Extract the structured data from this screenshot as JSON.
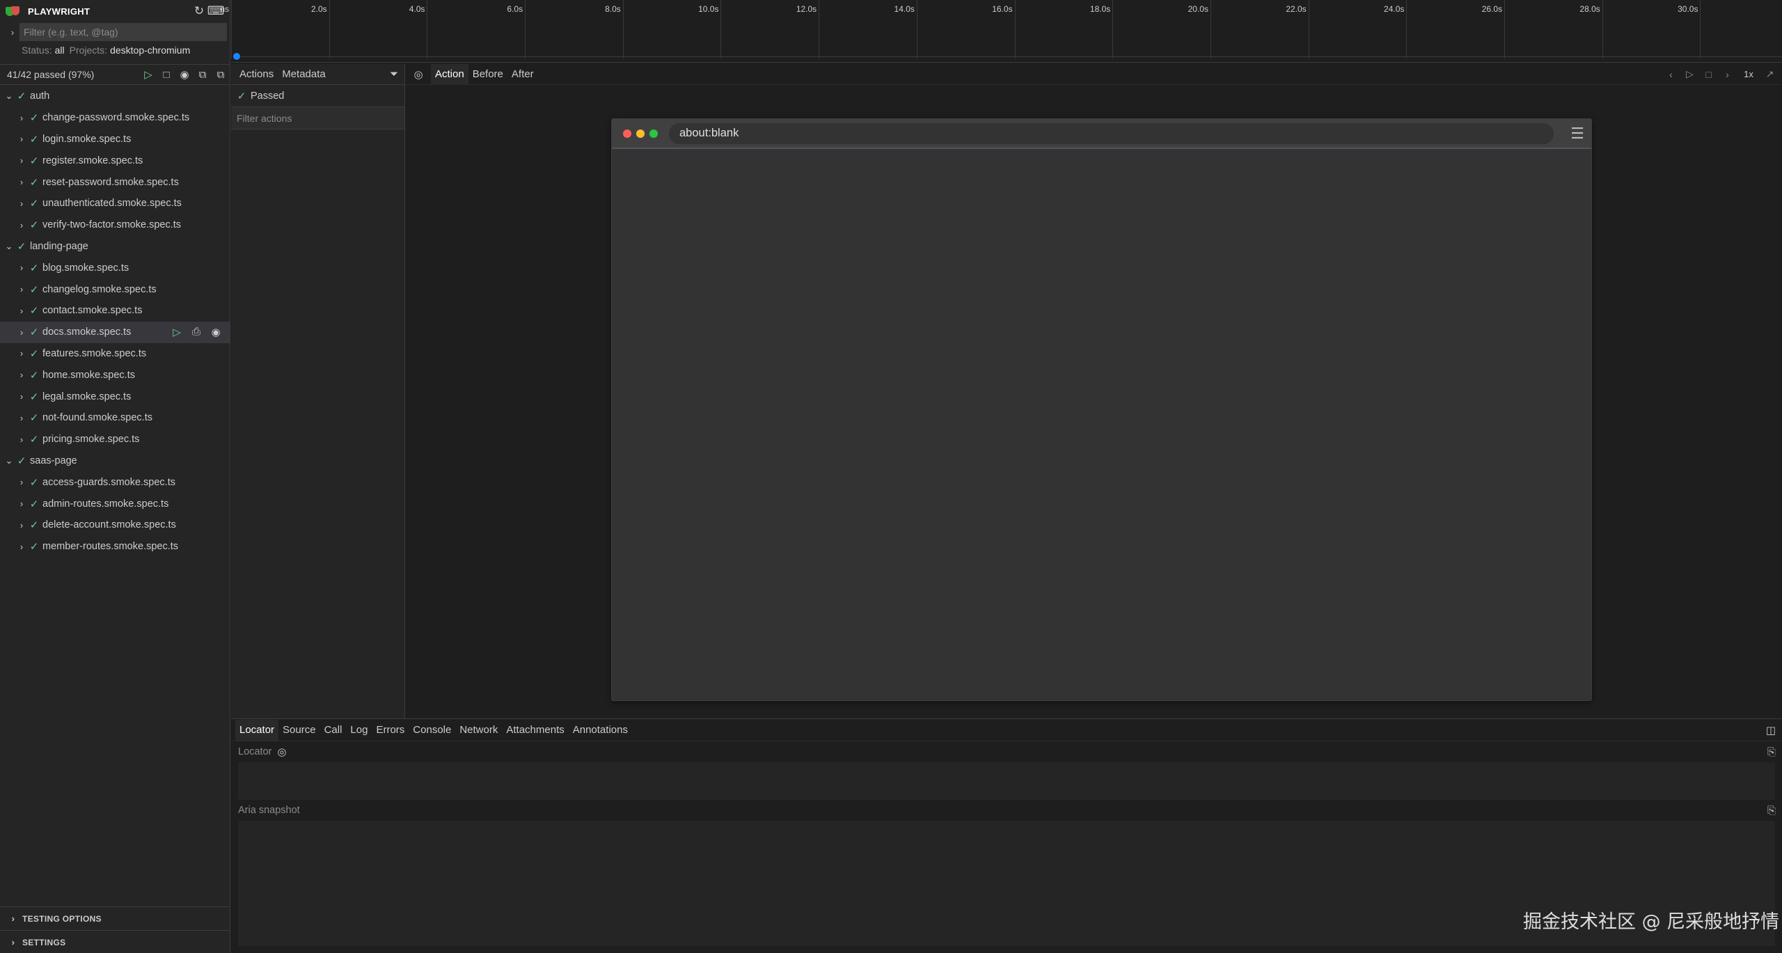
{
  "app": {
    "title": "PLAYWRIGHT"
  },
  "sidebar": {
    "filter_placeholder": "Filter (e.g. text, @tag)",
    "status_label": "Status:",
    "status_value": "all",
    "projects_label": "Projects:",
    "projects_value": "desktop-chromium",
    "summary": "41/42 passed (97%)",
    "groups": [
      {
        "name": "auth",
        "files": [
          "change-password.smoke.spec.ts",
          "login.smoke.spec.ts",
          "register.smoke.spec.ts",
          "reset-password.smoke.spec.ts",
          "unauthenticated.smoke.spec.ts",
          "verify-two-factor.smoke.spec.ts"
        ]
      },
      {
        "name": "landing-page",
        "files": [
          "blog.smoke.spec.ts",
          "changelog.smoke.spec.ts",
          "contact.smoke.spec.ts",
          "docs.smoke.spec.ts",
          "features.smoke.spec.ts",
          "home.smoke.spec.ts",
          "legal.smoke.spec.ts",
          "not-found.smoke.spec.ts",
          "pricing.smoke.spec.ts"
        ]
      },
      {
        "name": "saas-page",
        "files": [
          "access-guards.smoke.spec.ts",
          "admin-routes.smoke.spec.ts",
          "delete-account.smoke.spec.ts",
          "member-routes.smoke.spec.ts"
        ]
      }
    ],
    "selected_file": "docs.smoke.spec.ts",
    "footer": {
      "testing_options": "TESTING OPTIONS",
      "settings": "SETTINGS"
    }
  },
  "timeline": {
    "first_label": "ns",
    "ticks": [
      "2.0s",
      "4.0s",
      "6.0s",
      "8.0s",
      "10.0s",
      "12.0s",
      "14.0s",
      "16.0s",
      "18.0s",
      "20.0s",
      "22.0s",
      "24.0s",
      "26.0s",
      "28.0s",
      "30.0s"
    ]
  },
  "actions_panel": {
    "tabs": [
      "Actions",
      "Metadata"
    ],
    "passed_label": "Passed",
    "filter_placeholder": "Filter actions"
  },
  "snapshot": {
    "tabs": [
      "Action",
      "Before",
      "After"
    ],
    "active_tab": "Action",
    "speed": "1x",
    "url": "about:blank"
  },
  "bottom_panel": {
    "tabs": [
      "Locator",
      "Source",
      "Call",
      "Log",
      "Errors",
      "Console",
      "Network",
      "Attachments",
      "Annotations"
    ],
    "active_tab": "Locator",
    "locator_label": "Locator",
    "aria_label": "Aria snapshot"
  },
  "watermark": "掘金技术社区 @ 尼采般地抒情",
  "colors": {
    "accent": "#1a85ff",
    "pass": "#73c991",
    "background": "#1e1e1e",
    "sidebar": "#252526"
  }
}
